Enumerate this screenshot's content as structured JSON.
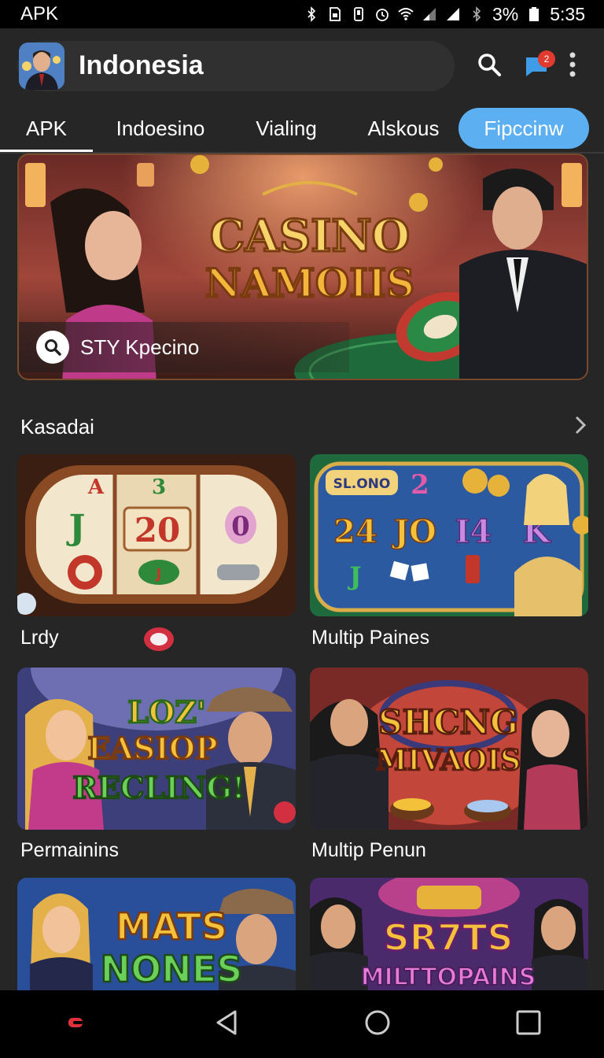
{
  "status_bar": {
    "left_text": "APK",
    "battery": "3%",
    "time": "5:35",
    "icons": [
      "bluetooth-icon",
      "sim-icon",
      "phone-icon",
      "alarm-icon",
      "wifi-icon",
      "signal-icon",
      "signal-icon",
      "bluetooth-icon",
      "battery-icon"
    ]
  },
  "header": {
    "title": "Indonesia",
    "notification_count": "2",
    "icons": [
      "avatar",
      "search-icon",
      "notification-icon",
      "more-vert-icon"
    ]
  },
  "tabs": [
    {
      "label": "APK",
      "active": true
    },
    {
      "label": "Indoesino",
      "active": false
    },
    {
      "label": "Vialing",
      "active": false
    },
    {
      "label": "Alskous",
      "active": false
    },
    {
      "label": "Fipccinw",
      "active": false,
      "highlighted": true
    }
  ],
  "banner": {
    "title_line1": "CASINO",
    "title_line2": "NAMOIIS",
    "search_text": "STY Kpecino"
  },
  "section": {
    "title": "Kasadai",
    "icon": "chevron-right-icon"
  },
  "games": [
    {
      "label": "Lrdy",
      "art": "slot reels",
      "reels": [
        "A",
        "3",
        "J",
        "20",
        "0",
        "J"
      ]
    },
    {
      "label": "Multip Paines",
      "art": "slot machine",
      "sign": "SL.ONO",
      "reels": [
        "2",
        "24",
        "JO",
        "I4",
        "K",
        "J"
      ]
    },
    {
      "label": "Permainins",
      "art_text": [
        "LOZ'",
        "EASIOP",
        "RECLING!"
      ]
    },
    {
      "label": "Multip Penun",
      "art_text": [
        "SHCNG",
        "MIVAOIS"
      ]
    },
    {
      "label": "",
      "art_text": [
        "MATS",
        "NONES"
      ]
    },
    {
      "label": "",
      "art_text": [
        "SR7TS",
        "MILTTOPAINS"
      ]
    }
  ],
  "colors": {
    "background": "#262626",
    "accent": "#5cb0f2",
    "badge": "#e13b2f",
    "title_gold": "#f6c64a"
  },
  "navbar": {
    "icons": [
      "app-logo-icon",
      "back-icon",
      "home-icon",
      "recents-icon"
    ]
  }
}
